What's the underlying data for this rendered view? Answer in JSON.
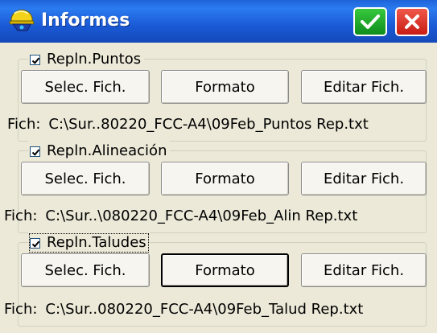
{
  "window": {
    "title": "Informes",
    "app_icon": "survey-helmet-icon",
    "ok_icon": "check-icon",
    "close_icon": "close-icon",
    "colors": {
      "titlebar": "#2b7bf0",
      "ok": "#1aa428",
      "close": "#e0372c"
    }
  },
  "groups": [
    {
      "label": "Repln.Puntos",
      "checked": true,
      "buttons": {
        "select": "Selec. Fich.",
        "format": "Formato",
        "edit": "Editar Fich."
      },
      "file_label": "Fich:",
      "file_path": "C:\\Sur..80220_FCC-A4\\09Feb_Puntos Rep.txt"
    },
    {
      "label": "Repln.Alineación",
      "checked": true,
      "buttons": {
        "select": "Selec. Fich.",
        "format": "Formato",
        "edit": "Editar Fich."
      },
      "file_label": "Fich:",
      "file_path": "C:\\Sur..\\080220_FCC-A4\\09Feb_Alin Rep.txt"
    },
    {
      "label": "Repln.Taludes",
      "checked": true,
      "buttons": {
        "select": "Selec. Fich.",
        "format": "Formato",
        "edit": "Editar Fich."
      },
      "file_label": "Fich:",
      "file_path": "C:\\Sur..080220_FCC-A4\\09Feb_Talud Rep.txt"
    }
  ]
}
